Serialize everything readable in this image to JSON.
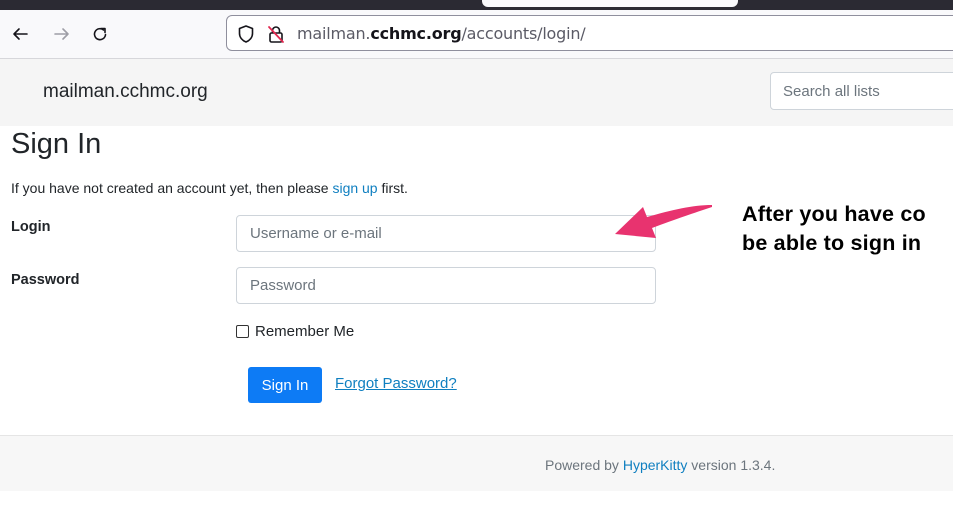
{
  "browser": {
    "url_prefix": "mailman.",
    "url_domain": "cchmc.org",
    "url_path": "/accounts/login/"
  },
  "header": {
    "brand": "mailman.cchmc.org",
    "search_placeholder": "Search all lists"
  },
  "main": {
    "title": "Sign In",
    "intro_before": "If you have not created an account yet, then please ",
    "intro_link": "sign up",
    "intro_after": " first.",
    "login_label": "Login",
    "login_placeholder": "Username or e-mail",
    "password_label": "Password",
    "password_placeholder": "Password",
    "remember_label": "Remember Me",
    "signin_label": "Sign In",
    "forgot_label": "Forgot Password?"
  },
  "annotation": {
    "line1": "After you have co",
    "line2": "be able to sign in"
  },
  "footer": {
    "before": "Powered by ",
    "link": "HyperKitty",
    "after": " version 1.3.4."
  },
  "colors": {
    "link": "#0f7fc0",
    "primary_button": "#0d7bf5",
    "arrow": "#e8336f"
  }
}
